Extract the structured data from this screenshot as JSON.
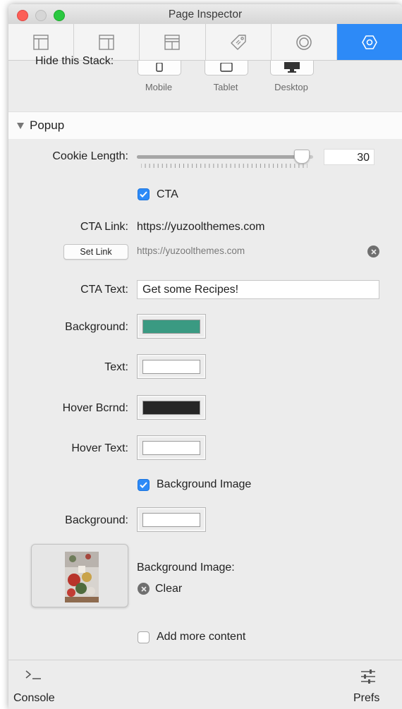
{
  "window": {
    "title": "Page Inspector"
  },
  "colors": {
    "accent": "#2d8af7",
    "cta_background": "#3a9a82",
    "text_color": "#ffffff",
    "hover_background": "#262626",
    "hover_text": "#ffffff",
    "popup_background": "#ffffff"
  },
  "tabs": [
    {
      "icon": "page-layout-icon"
    },
    {
      "icon": "sidebar-layout-icon"
    },
    {
      "icon": "header-layout-icon"
    },
    {
      "icon": "tag-icon"
    },
    {
      "icon": "circle-target-icon"
    },
    {
      "icon": "hexagon-settings-icon",
      "active": true
    }
  ],
  "visibility": {
    "label": "Hide this Stack:",
    "devices": [
      {
        "label": "Mobile",
        "icon": "phone-icon"
      },
      {
        "label": "Tablet",
        "icon": "tablet-icon"
      },
      {
        "label": "Desktop",
        "icon": "monitor-icon"
      }
    ]
  },
  "popup": {
    "section_title": "Popup",
    "cookie_length": {
      "label": "Cookie Length:",
      "value": "30",
      "fraction": 0.93
    },
    "cta": {
      "label": "CTA",
      "checked": true
    },
    "cta_link": {
      "label": "CTA Link:",
      "value": "https://yuzoolthemes.com",
      "button": "Set Link",
      "url": "https://yuzoolthemes.com"
    },
    "cta_text": {
      "label": "CTA Text:",
      "value": "Get some Recipes!"
    },
    "background": {
      "label": "Background:"
    },
    "text": {
      "label": "Text:"
    },
    "hover_bcrnd": {
      "label": "Hover Bcrnd:"
    },
    "hover_text": {
      "label": "Hover Text:"
    },
    "background_image_toggle": {
      "label": "Background Image",
      "checked": true
    },
    "background2": {
      "label": "Background:"
    },
    "background_image": {
      "label": "Background Image:",
      "clear": "Clear"
    },
    "add_more": {
      "label": "Add more content",
      "checked": false
    }
  },
  "footer": {
    "console": "Console",
    "prefs": "Prefs"
  }
}
